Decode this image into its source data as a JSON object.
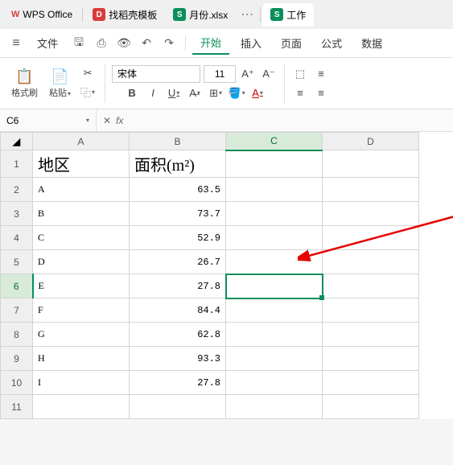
{
  "tabs": {
    "app_name": "WPS Office",
    "items": [
      {
        "icon_bg": "#d83b3b",
        "icon_text": "D",
        "label": "找稻壳模板"
      },
      {
        "icon_bg": "#0a8f5b",
        "icon_text": "S",
        "label": "月份.xlsx"
      },
      {
        "icon_bg": "#0a8f5b",
        "icon_text": "S",
        "label": "工作"
      }
    ]
  },
  "menu": {
    "file": "文件",
    "items": [
      "开始",
      "插入",
      "页面",
      "公式",
      "数据"
    ],
    "active_index": 0
  },
  "toolbar": {
    "format_painter": "格式刷",
    "paste": "粘贴",
    "font_name": "宋体",
    "font_size": "11",
    "bold": "B",
    "italic": "I",
    "underline": "U",
    "a_increase": "A⁺",
    "a_decrease": "A⁻"
  },
  "formula_bar": {
    "cell_ref": "C6",
    "fx": "fx"
  },
  "sheet": {
    "columns": [
      "A",
      "B",
      "C",
      "D"
    ],
    "selected_col": "C",
    "selected_row": 6,
    "headers": {
      "A": "地区",
      "B": "面积(m²)"
    },
    "rows": [
      {
        "region": "A",
        "area": "63.5"
      },
      {
        "region": "B",
        "area": "73.7"
      },
      {
        "region": "C",
        "area": "52.9"
      },
      {
        "region": "D",
        "area": "26.7"
      },
      {
        "region": "E",
        "area": "27.8"
      },
      {
        "region": "F",
        "area": "84.4"
      },
      {
        "region": "G",
        "area": "62.8"
      },
      {
        "region": "H",
        "area": "93.3"
      },
      {
        "region": "I",
        "area": "27.8"
      }
    ]
  }
}
